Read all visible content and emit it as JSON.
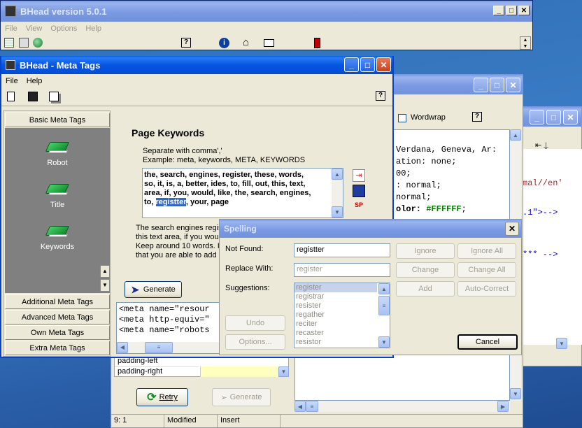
{
  "bhead_main": {
    "title": "BHead version 5.0.1",
    "menu": [
      "File",
      "View",
      "Options",
      "Help"
    ]
  },
  "meta_tags_window": {
    "title": "BHead - Meta Tags",
    "menu": [
      "File",
      "Help"
    ],
    "panel": {
      "header": "Basic Meta Tags",
      "items": [
        "Robot",
        "Title",
        "Keywords"
      ],
      "sections": [
        "Additional Meta Tags",
        "Advanced Meta Tags",
        "Own Meta Tags",
        "Extra Meta Tags"
      ]
    },
    "keywords": {
      "heading": "Page Keywords",
      "hint1": "Separate with comma','",
      "hint2": "Example: meta, keywords, META, KEYWORDS",
      "line1": "the, search, engines, register, these, words,",
      "line2": "so, it, is, a, better, ides, to, fill, out, this, text,",
      "line3": "area, if, you, would, like, the, search, engines,",
      "line4_pre": "to, ",
      "line4_sel": "registter",
      "line4_post": ", your, page",
      "desc1": "The search engines regis",
      "desc2": "this text area, if you would",
      "desc3": "Keep around 10 words. It",
      "desc4": "that you are able to add K"
    },
    "generate_label": "Generate",
    "code_lines": [
      "<meta name=\"resour",
      "<meta http-equiv=\"",
      "<meta name=\"robots"
    ]
  },
  "editor_window": {
    "wordwrap_label": "Wordwrap",
    "code_lines": [
      "Verdana, Geneva, Ar:",
      "ation: none;",
      "00;",
      ": normal;",
      "normal;",
      "olor: #FFFFFF;"
    ],
    "color_value": "#FFFFFF",
    "props": [
      "padding-left",
      "padding-right"
    ],
    "retry_label": "Retry",
    "generate_label": "Generate",
    "status": {
      "pos": "9: 1",
      "state": "Modified",
      "mode": "Insert"
    }
  },
  "third_window": {
    "lines": [
      "mal//en'",
      ".1\">-->",
      "*** -->"
    ]
  },
  "spelling": {
    "title": "Spelling",
    "not_found_label": "Not Found:",
    "not_found_value": "registter",
    "replace_label": "Replace With:",
    "replace_value": "register",
    "suggestions_label": "Suggestions:",
    "suggestions": [
      "register",
      "registrar",
      "resister",
      "regather",
      "reciter",
      "recaster",
      "resistor"
    ],
    "buttons": {
      "ignore": "Ignore",
      "ignore_all": "Ignore All",
      "change": "Change",
      "change_all": "Change All",
      "add": "Add",
      "auto_correct": "Auto-Correct",
      "undo": "Undo",
      "options": "Options...",
      "cancel": "Cancel"
    }
  }
}
